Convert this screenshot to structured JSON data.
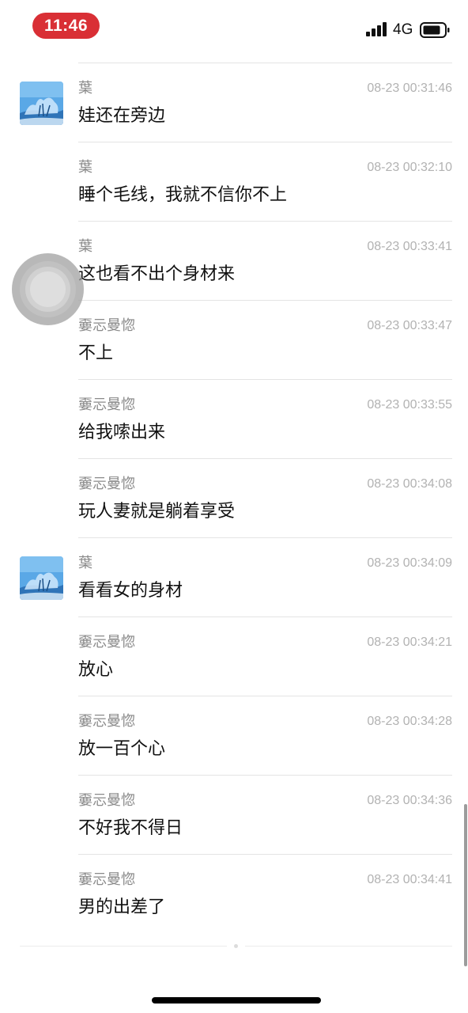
{
  "status_bar": {
    "time": "11:46",
    "network": "4G",
    "time_pill_color": "#d92f35",
    "battery_level": 0.8,
    "signal_bars": 4
  },
  "messages": [
    {
      "sender": "葉",
      "time": "08-23 00:31:46",
      "text": "娃还在旁边",
      "avatar": "snow-tree-photo"
    },
    {
      "sender": "葉",
      "time": "08-23 00:32:10",
      "text": "睡个毛线，我就不信你不上"
    },
    {
      "sender": "葉",
      "time": "08-23 00:33:41",
      "text": "这也看不出个身材来"
    },
    {
      "sender": "嫑忈曼惚",
      "time": "08-23 00:33:47",
      "text": "不上"
    },
    {
      "sender": "嫑忈曼惚",
      "time": "08-23 00:33:55",
      "text": "给我嗦出来"
    },
    {
      "sender": "嫑忈曼惚",
      "time": "08-23 00:34:08",
      "text": "玩人妻就是躺着享受"
    },
    {
      "sender": "葉",
      "time": "08-23 00:34:09",
      "text": "看看女的身材",
      "avatar": "snow-tree-photo"
    },
    {
      "sender": "嫑忈曼惚",
      "time": "08-23 00:34:21",
      "text": "放心"
    },
    {
      "sender": "嫑忈曼惚",
      "time": "08-23 00:34:28",
      "text": "放一百个心"
    },
    {
      "sender": "嫑忈曼惚",
      "time": "08-23 00:34:36",
      "text": "不好我不得日"
    },
    {
      "sender": "嫑忈曼惚",
      "time": "08-23 00:34:41",
      "text": "男的出差了"
    }
  ],
  "colors": {
    "sender": "#8a8a8a",
    "timestamp": "#b2b2b2",
    "message": "#111111",
    "divider": "#e4e4e4"
  }
}
